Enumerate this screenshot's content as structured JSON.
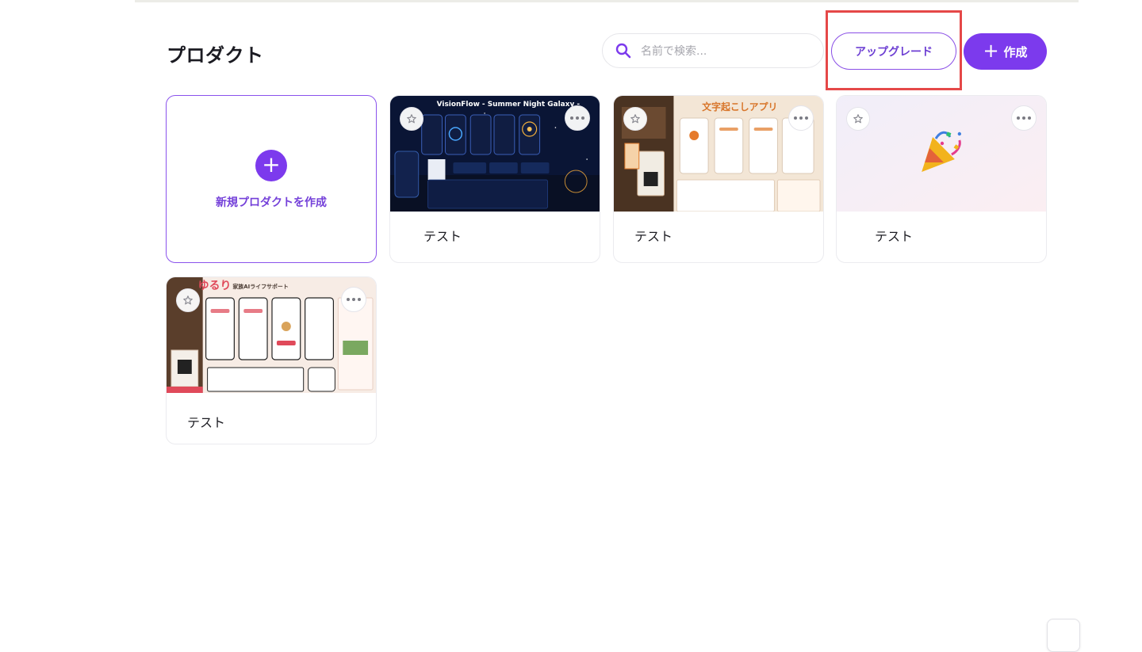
{
  "page": {
    "title": "プロダクト"
  },
  "search": {
    "placeholder": "名前で検索..."
  },
  "actions": {
    "upgrade_label": "アップグレード",
    "create_label": "作成"
  },
  "new_product": {
    "label": "新規プロダクトを作成"
  },
  "thumbnail_texts": {
    "visionflow_title": "VisionFlow - Summer Night Galaxy -",
    "transcription_title": "文字起こしアプリ",
    "yururi_logo": "ゆるり",
    "yururi_subtitle": "家族AIライフサポート"
  },
  "products": [
    {
      "name": "テスト",
      "thumbnail": "visionflow-summer-night-galaxy"
    },
    {
      "name": "テスト",
      "thumbnail": "transcription-app"
    },
    {
      "name": "テスト",
      "thumbnail": "party-popper"
    },
    {
      "name": "テスト",
      "thumbnail": "yururi-family-ai"
    }
  ],
  "colors": {
    "accent": "#7c3aed",
    "highlight": "#e54848"
  }
}
